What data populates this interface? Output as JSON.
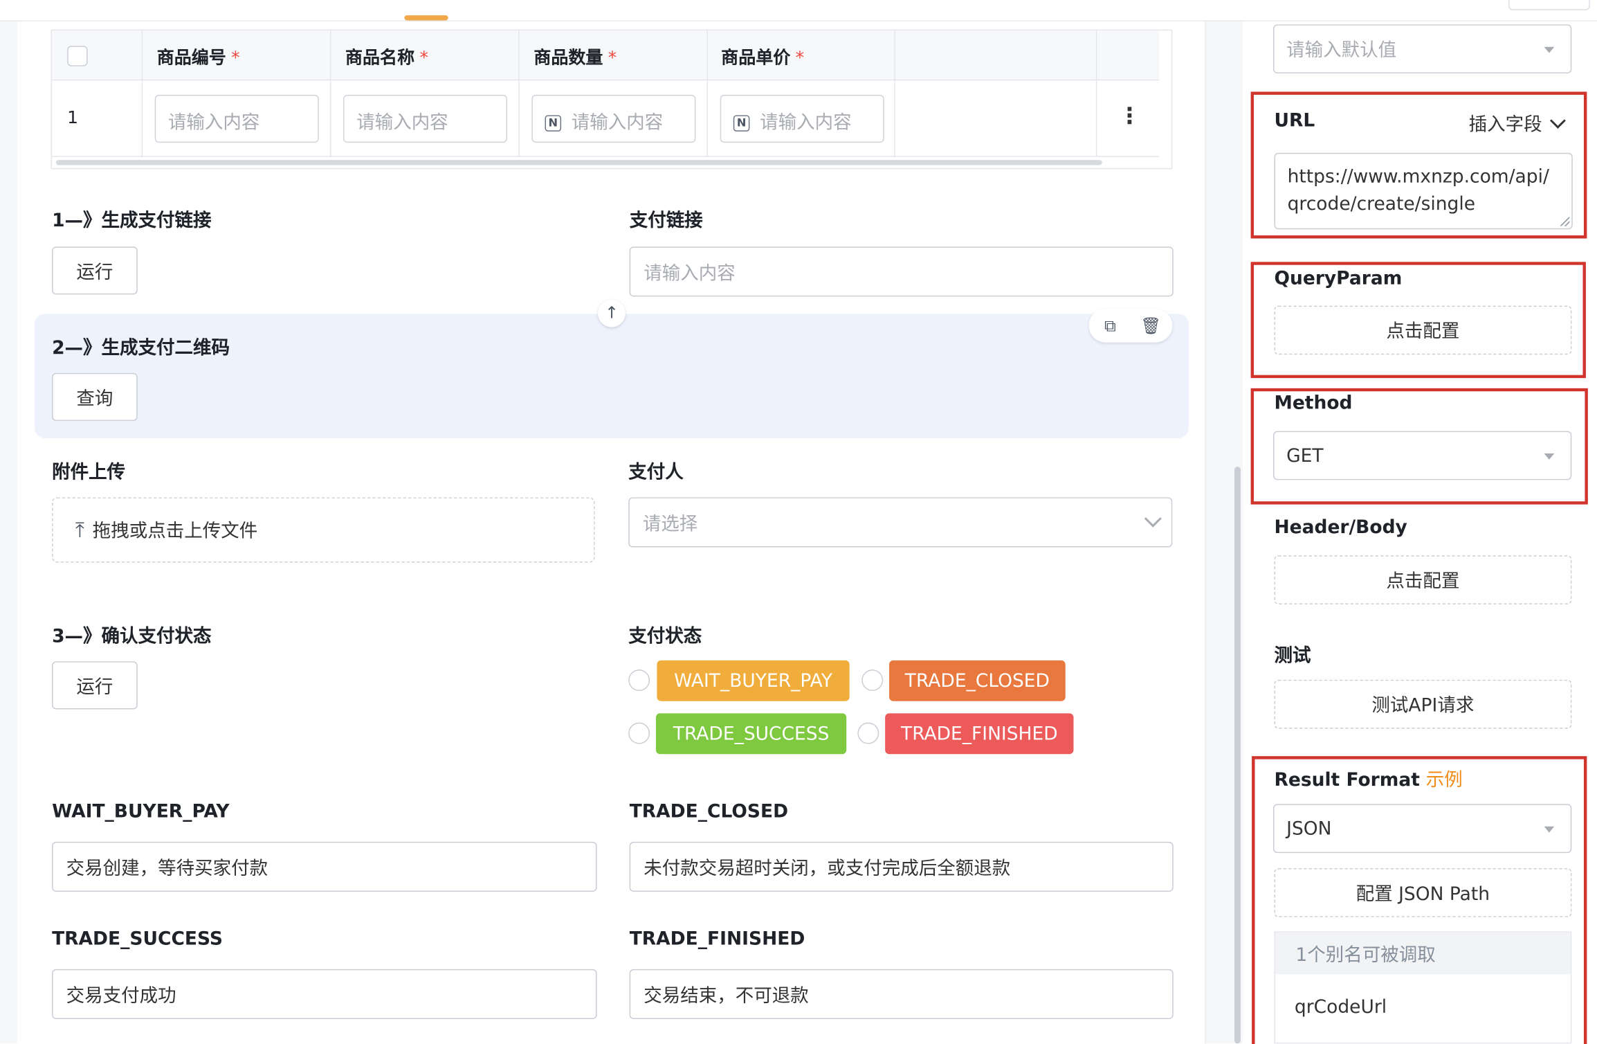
{
  "table": {
    "columns": [
      {
        "label": "商品编号",
        "required": "*"
      },
      {
        "label": "商品名称",
        "required": "*"
      },
      {
        "label": "商品数量",
        "required": "*"
      },
      {
        "label": "商品单价",
        "required": "*"
      }
    ],
    "row": {
      "index": "1",
      "placeholders": [
        "请输入内容",
        "请输入内容",
        "请输入内容",
        "请输入内容"
      ],
      "number_icon": "N",
      "more_icon": "⋮"
    }
  },
  "step1": {
    "label": "1—》生成支付链接",
    "button": "运行"
  },
  "pay_link": {
    "label": "支付链接",
    "placeholder": "请输入内容"
  },
  "step2": {
    "label": "2—》生成支付二维码",
    "button": "查询"
  },
  "attachment": {
    "label": "附件上传",
    "upload_text": "拖拽或点击上传文件"
  },
  "payer": {
    "label": "支付人",
    "placeholder": "请选择"
  },
  "step3": {
    "label": "3—》确认支付状态",
    "button": "运行"
  },
  "pay_status": {
    "label": "支付状态",
    "options": [
      {
        "text": "WAIT_BUYER_PAY",
        "color": "#f0ad3c"
      },
      {
        "text": "TRADE_CLOSED",
        "color": "#e9783f"
      },
      {
        "text": "TRADE_SUCCESS",
        "color": "#7ec940"
      },
      {
        "text": "TRADE_FINISHED",
        "color": "#ec5a5a"
      }
    ]
  },
  "status_fields": [
    {
      "label": "WAIT_BUYER_PAY",
      "value": "交易创建，等待买家付款"
    },
    {
      "label": "TRADE_CLOSED",
      "value": "未付款交易超时关闭，或支付完成后全额退款"
    },
    {
      "label": "TRADE_SUCCESS",
      "value": "交易支付成功"
    },
    {
      "label": "TRADE_FINISHED",
      "value": "交易结束，不可退款"
    }
  ],
  "right_panel": {
    "default_value_placeholder": "请输入默认值",
    "url": {
      "label": "URL",
      "insert_field": "插入字段",
      "value": "https://www.mxnzp.com/api/qrcode/create/single"
    },
    "query_param": {
      "label": "QueryParam",
      "button": "点击配置"
    },
    "method": {
      "label": "Method",
      "value": "GET"
    },
    "header_body": {
      "label": "Header/Body",
      "button": "点击配置"
    },
    "test": {
      "label": "测试",
      "button": "测试API请求"
    },
    "result_format": {
      "label": "Result Format",
      "example": "示例",
      "value": "JSON",
      "json_path_button": "配置 JSON Path",
      "alias_header": "1个别名可被调取",
      "alias": "qrCodeUrl"
    }
  },
  "colors": {
    "accent": "#f0a84a",
    "highlight": "#d0342c",
    "section_bg": "#edf2fc"
  }
}
